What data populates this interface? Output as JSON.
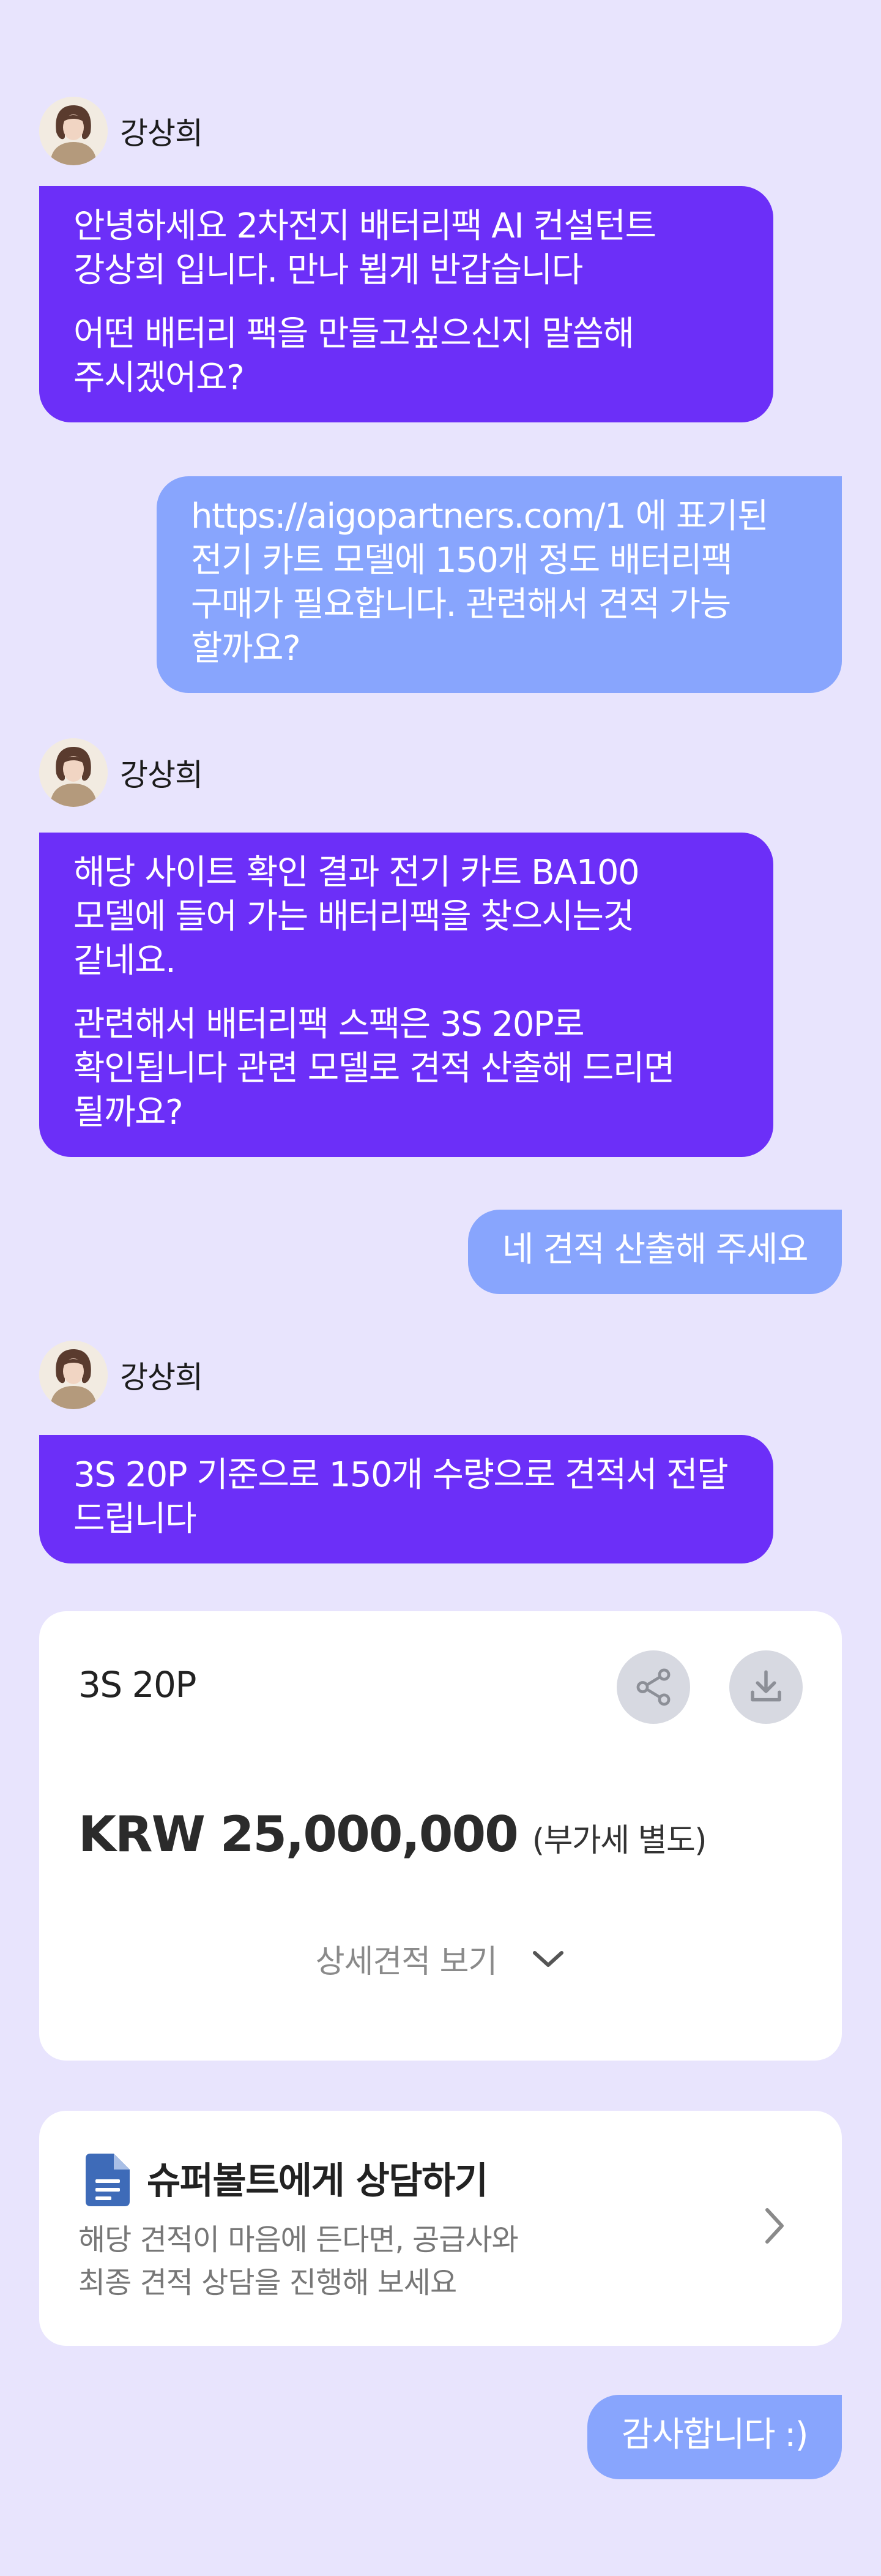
{
  "messages": {
    "m1": {
      "sender": "강상희",
      "paragraphs": [
        "안녕하세요 2차전지 배터리팩 AI 컨설턴트 강상희 입니다. 만나 뵙게 반갑습니다",
        "어떤 배터리 팩을 만들고싶으신지 말씀해 주시겠어요?"
      ]
    },
    "m2": {
      "text": "https://aigopartners.com/1 에 표기된 전기 카트 모델에 150개 정도 배터리팩 구매가 필요합니다. 관련해서 견적 가능 할까요?"
    },
    "m3": {
      "sender": "강상희",
      "paragraphs": [
        "해당 사이트 확인 결과 전기 카트 BA100 모델에 들어 가는 배터리팩을 찾으시는것 같네요.",
        "관련해서 배터리팩 스팩은 3S 20P로 확인됩니다 관련 모델로 견적 산출해 드리면 될까요?"
      ]
    },
    "m4": {
      "text": "네 견적 산출해 주세요"
    },
    "m5": {
      "sender": "강상희",
      "paragraphs": [
        "3S 20P 기준으로 150개 수량으로 견적서 전달 드립니다"
      ]
    },
    "m6": {
      "text": "감사합니다 :)"
    }
  },
  "quote": {
    "model": "3S 20P",
    "price": "KRW 25,000,000",
    "vat_note": "(부가세 별도)",
    "detail_label": "상세견적 보기",
    "share_icon": "share-icon",
    "download_icon": "download-icon"
  },
  "consult": {
    "title": "슈퍼볼트에게  상담하기",
    "desc_line1": "해당 견적이 마음에 든다면, 공급사와",
    "desc_line2": "최종 견적 상담을 진행해 보세요",
    "icon": "document-icon"
  },
  "colors": {
    "background": "#e8e4fd",
    "bot_bubble": "#6c2ff8",
    "user_bubble": "#88a5fd",
    "card": "#ffffff",
    "doc_icon": "#3e6bb8"
  }
}
